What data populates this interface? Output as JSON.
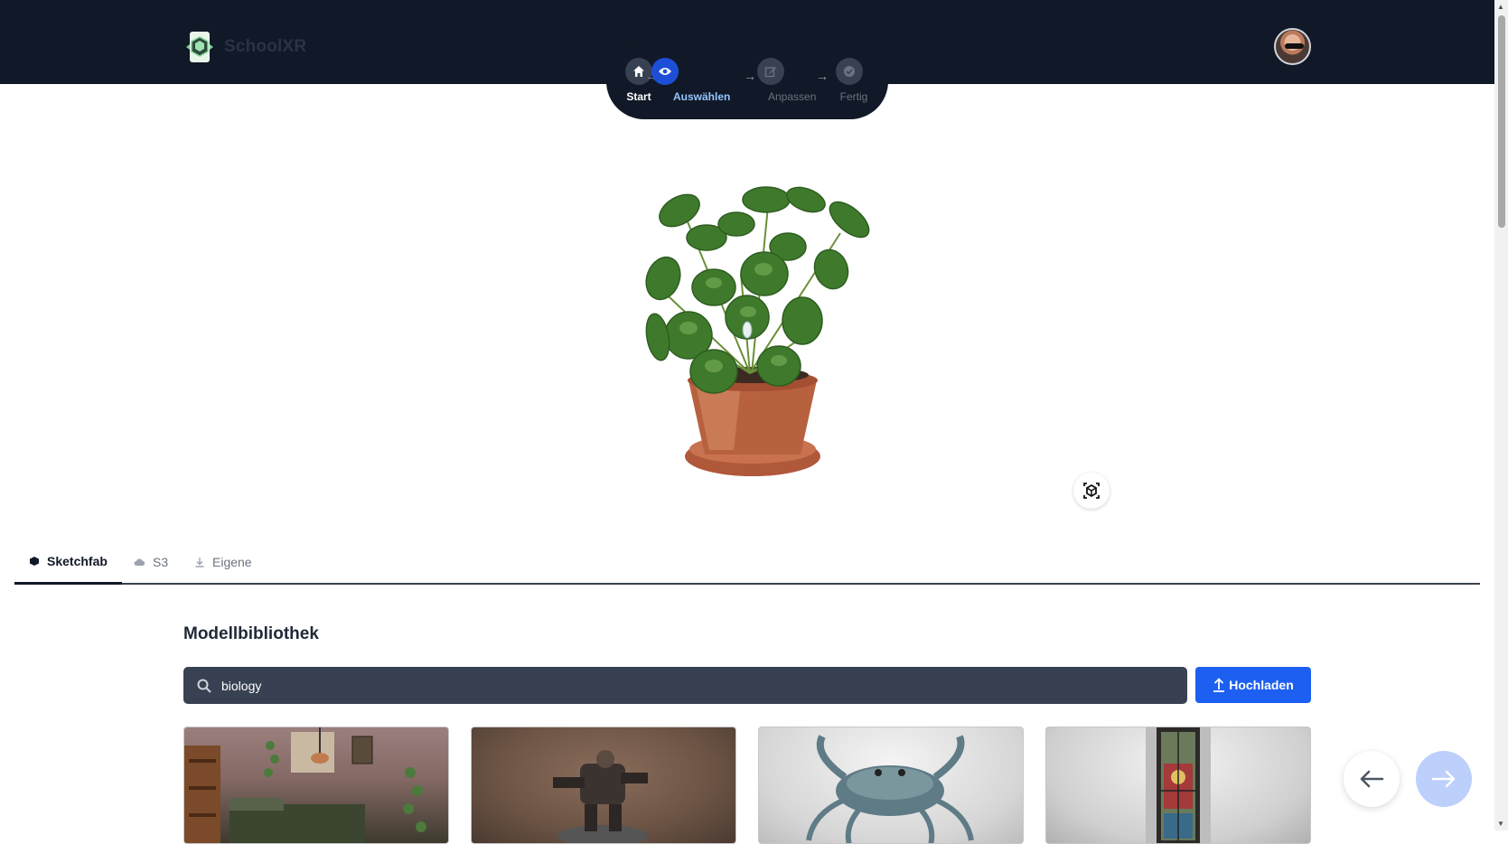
{
  "header": {
    "brand_name": "SchoolXR",
    "avatar_alt": "user-avatar"
  },
  "stepper": {
    "steps": [
      {
        "label": "Start",
        "icon": "home-icon",
        "state": "done"
      },
      {
        "label": "Auswählen",
        "icon": "eye-icon",
        "state": "active"
      },
      {
        "label": "Anpassen",
        "icon": "edit-icon",
        "state": "pending"
      },
      {
        "label": "Fertig",
        "icon": "check-circle-icon",
        "state": "pending"
      }
    ]
  },
  "viewer": {
    "ar_button_icon": "ar-cube-icon"
  },
  "tabs": [
    {
      "label": "Sketchfab",
      "icon": "cube-icon",
      "active": true
    },
    {
      "label": "S3",
      "icon": "cloud-icon",
      "active": false
    },
    {
      "label": "Eigene",
      "icon": "download-icon",
      "active": false
    }
  ],
  "library": {
    "title": "Modellbibliothek",
    "search_value": "biology",
    "upload_label": "Hochladen"
  },
  "colors": {
    "topbar": "#111827",
    "accent": "#1d5ff0",
    "search_bg": "#374151"
  }
}
